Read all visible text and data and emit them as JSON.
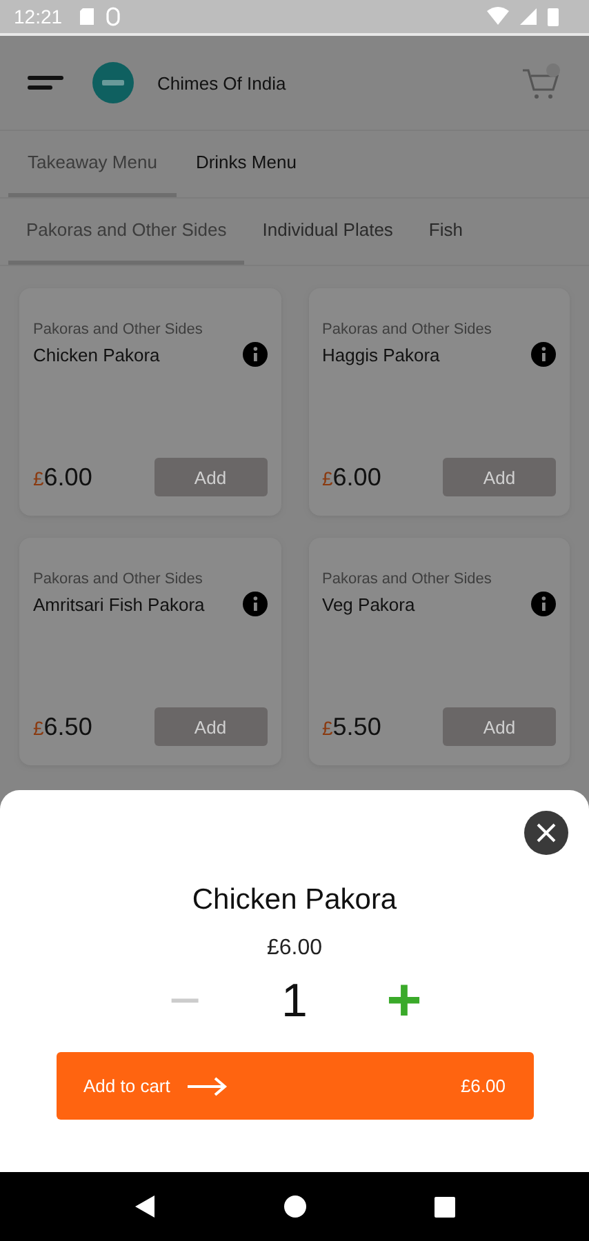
{
  "status_bar": {
    "time": "12:21"
  },
  "header": {
    "title": "Chimes Of India"
  },
  "menu_tabs": [
    {
      "label": "Takeaway Menu",
      "selected": true
    },
    {
      "label": "Drinks Menu",
      "selected": false
    }
  ],
  "category_tabs": [
    {
      "label": "Pakoras and Other Sides",
      "selected": true
    },
    {
      "label": "Individual Plates",
      "selected": false
    },
    {
      "label": "Fish",
      "selected": false
    }
  ],
  "items": [
    {
      "category": "Pakoras and Other Sides",
      "name": "Chicken Pakora",
      "currency": "£",
      "amount": "6.00",
      "button": "Add"
    },
    {
      "category": "Pakoras and Other Sides",
      "name": "Haggis Pakora",
      "currency": "£",
      "amount": "6.00",
      "button": "Add"
    },
    {
      "category": "Pakoras and Other Sides",
      "name": "Amritsari Fish Pakora",
      "currency": "£",
      "amount": "6.50",
      "button": "Add"
    },
    {
      "category": "Pakoras and Other Sides",
      "name": "Veg Pakora",
      "currency": "£",
      "amount": "5.50",
      "button": "Add"
    }
  ],
  "sheet": {
    "name": "Chicken Pakora",
    "price": "£6.00",
    "minus": "−",
    "quantity": "1",
    "plus": "+",
    "button": "Add to cart",
    "total": "£6.00"
  }
}
